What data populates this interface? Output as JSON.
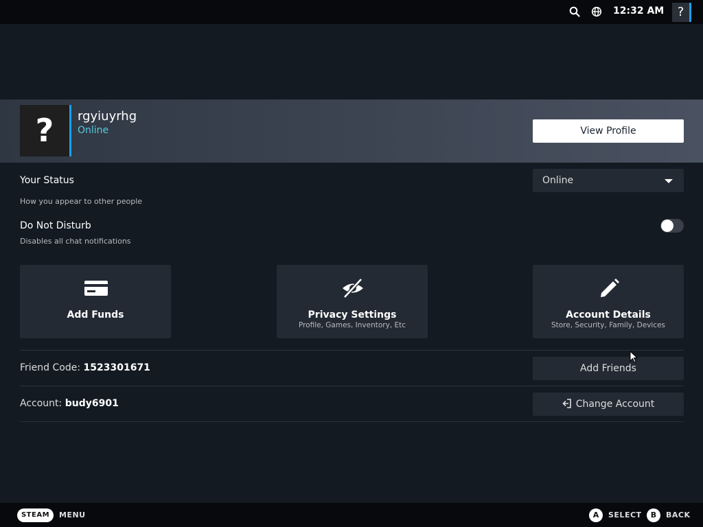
{
  "topbar": {
    "time": "12:32 AM",
    "help_label": "?",
    "icons": [
      "search-icon",
      "globe-icon"
    ]
  },
  "profile": {
    "avatar_placeholder": "?",
    "username": "rgyiuyrhg",
    "status": "Online",
    "view_profile_label": "View Profile"
  },
  "settings": {
    "your_status_label": "Your Status",
    "your_status_sub": "How you appear to other people",
    "status_selected": "Online",
    "dnd_label": "Do Not Disturb",
    "dnd_sub": "Disables all chat notifications",
    "dnd_enabled": false
  },
  "tiles": [
    {
      "title": "Add Funds",
      "subtitle": "",
      "icon": "credit-card-icon"
    },
    {
      "title": "Privacy Settings",
      "subtitle": "Profile, Games, Inventory, Etc",
      "icon": "eye-slash-icon"
    },
    {
      "title": "Account Details",
      "subtitle": "Store, Security, Family, Devices",
      "icon": "pencil-icon"
    }
  ],
  "friend_code": {
    "label": "Friend Code:",
    "value": "1523301671",
    "button": "Add Friends"
  },
  "account": {
    "label": "Account:",
    "value": "budy6901",
    "button": "Change Account"
  },
  "bottombar": {
    "steam_label": "STEAM",
    "menu_label": "MENU",
    "a_label": "A",
    "select_label": "SELECT",
    "b_label": "B",
    "back_label": "BACK"
  },
  "colors": {
    "accent": "#1a9fff",
    "online": "#57cbde",
    "background": "#131a22",
    "tile": "#232a33"
  }
}
